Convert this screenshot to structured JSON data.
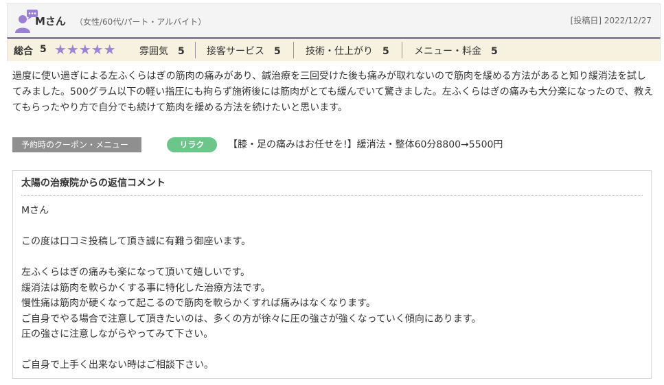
{
  "reviewer": {
    "name": "Mさん",
    "meta": "（女性/60代/パート・アルバイト）",
    "post_date": "[投稿日] 2022/12/27"
  },
  "ratings": {
    "overall_label": "総合",
    "overall_score": "5",
    "stars": "★★★★★",
    "star_count": 5,
    "star_color": "#9d84d6",
    "items": [
      {
        "label": "雰囲気",
        "score": "5"
      },
      {
        "label": "接客サービス",
        "score": "5"
      },
      {
        "label": "技術・仕上がり",
        "score": "5"
      },
      {
        "label": "メニュー・料金",
        "score": "5"
      }
    ]
  },
  "review": {
    "text": "過度に使い過ぎによる左ふくらはぎの筋肉の痛みがあり、鍼治療を三回受けた後も痛みが取れないので筋肉を緩める方法があると知り緩消法を試してみました。500グラム以下の軽い指圧にも拘らず施術後には筋肉がとても緩んでいて驚きました。左ふくらはぎの痛みも大分楽になったので、教えてもらったやり方で自分でも続けて筋肉を緩める方法を続けたいと思います。"
  },
  "coupon": {
    "label": "予約時のクーポン・メニュー",
    "tag": "リラク",
    "tag_color": "#6cc68a",
    "text": "【膝・足の痛みはお任せを!】緩消法・整体60分8800→5500円"
  },
  "reply": {
    "title": "太陽の治療院からの返信コメント",
    "lines": [
      "Mさん",
      "",
      "この度は口コミ投稿して頂き誠に有難う御座います。",
      "",
      "左ふくらはぎの痛みも楽になって頂いて嬉しいです。",
      "緩消法は筋肉を軟らかくする事に特化した治療方法です。",
      "慢性痛は筋肉が硬くなって起こるので筋肉を軟らかくすれば痛みはなくなります。",
      "ご自身でやる場合で注意して頂きたいのは、多くの方が徐々に圧の強さが強くなっていく傾向にあります。",
      "圧の強さに注意しながらやってみて下さい。",
      "",
      "ご自身で上手く出来ない時はご相談下さい。"
    ]
  }
}
